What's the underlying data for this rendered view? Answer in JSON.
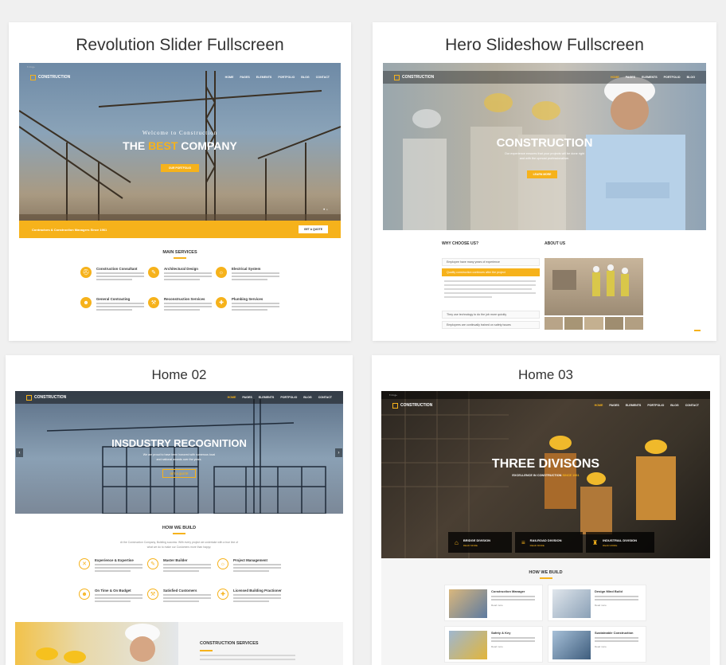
{
  "cards": [
    {
      "title": "Revolution Slider Fullscreen",
      "logo": "CONSTRUCTION",
      "menu": [
        "HOME",
        "PAGES",
        "ELEMENTS",
        "PORTFOLIO",
        "BLOG",
        "CONTACT"
      ],
      "hero_kicker": "Welcome to Construction",
      "hero_title_pre": "THE",
      "hero_title_accent": "BEST",
      "hero_title_post": "COMPANY",
      "hero_button": "OUR PORTFOLIO",
      "banner_text": "Contractors & Construction Managers Since 1961",
      "banner_button": "GET A QUOTE",
      "section_title": "MAIN SERVICES",
      "services": [
        {
          "title": "Construction Consultant",
          "icon": "hard-hat"
        },
        {
          "title": "Architectural Design",
          "icon": "compass"
        },
        {
          "title": "Electrical System",
          "icon": "bulb"
        },
        {
          "title": "General Contracting",
          "icon": "worker"
        },
        {
          "title": "Reconstruction Services",
          "icon": "crane"
        },
        {
          "title": "Plumbing Services",
          "icon": "wrench"
        }
      ]
    },
    {
      "title": "Hero Slideshow Fullscreen",
      "logo": "CONSTRUCTION",
      "menu": [
        "HOME",
        "PAGES",
        "ELEMENTS",
        "PORTFOLIO",
        "BLOG"
      ],
      "hero_title": "CONSTRUCTION",
      "hero_sub_1": "Our experience ensures that your projects will be done right",
      "hero_sub_2": "and with the upmost professionalism.",
      "hero_button": "LEARN MORE",
      "why_title": "WHY CHOOSE US?",
      "about_title": "ABOUT US",
      "accordion": [
        "Employee have many years of experience",
        "Quality construction continues after the project",
        "They use technology to do the job more quickly",
        "Employees are continually trained on safety issues"
      ]
    },
    {
      "title": "Home 02",
      "logo": "CONSTRUCTION",
      "menu": [
        "HOME",
        "PAGES",
        "ELEMENTS",
        "PORTFOLIO",
        "BLOG",
        "CONTACT"
      ],
      "hero_title": "INSDUSTRY RECOGNITION",
      "hero_sub_1": "We are proud to have been honored with numerous local",
      "hero_sub_2": "and national awards over the years.",
      "hero_button": "GET A QUOTE",
      "section_title": "HOW WE BUILD",
      "intro_1": "At the Construction Company, Building success: With every project we undertake with a true line of",
      "intro_2": "what we do to make our Customers more than happy.",
      "features": [
        {
          "title": "Experience & Expertise",
          "icon": "badge"
        },
        {
          "title": "Master Builder",
          "icon": "compass"
        },
        {
          "title": "Project Management",
          "icon": "bulb"
        },
        {
          "title": "On Time & On Budget",
          "icon": "worker"
        },
        {
          "title": "Satisfied Customers",
          "icon": "crane"
        },
        {
          "title": "Licensed Building Practioner",
          "icon": "wrench"
        }
      ],
      "bottom_title": "CONSTRUCTION SERVICES"
    },
    {
      "title": "Home 03",
      "logo": "CONSTRUCTION",
      "menu": [
        "HOME",
        "PAGES",
        "ELEMENTS",
        "PORTFOLIO",
        "BLOG",
        "CONTACT"
      ],
      "hero_title": "THREE DIVISONS",
      "hero_sub_pre": "EXCELLENCE IN CONSTRUCTION",
      "hero_sub_accent": "SINCE 1961",
      "divisions": [
        {
          "title": "BRIDGE DIVISION",
          "more": "READ MORE",
          "icon": "bridge"
        },
        {
          "title": "RAILROAD DIVISION",
          "more": "READ MORE",
          "icon": "railroad"
        },
        {
          "title": "INDUSTRIAL DIVISION",
          "more": "READ MORE",
          "icon": "factory"
        }
      ],
      "section_title": "HOW WE BUILD",
      "tiles": [
        {
          "title": "Construction Manager",
          "more": "Read more"
        },
        {
          "title": "Design Mind Build",
          "more": "Read more"
        },
        {
          "title": "Safety & Key",
          "more": "Read more"
        },
        {
          "title": "Sustainable Construction",
          "more": "Read more"
        }
      ]
    }
  ],
  "colors": {
    "accent": "#f6b21b",
    "dark_nav": "#1d1d1d",
    "background": "#f0f0f0"
  }
}
